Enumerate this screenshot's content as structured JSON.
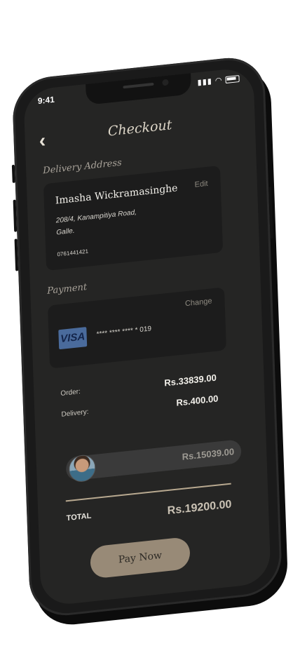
{
  "status": {
    "time": "9:41",
    "signal": "▮▮▮",
    "wifi": "◠"
  },
  "header": {
    "back_icon": "chevron-left-icon",
    "back_glyph": "‹",
    "title": "Checkout"
  },
  "delivery": {
    "label": "Delivery Address",
    "name": "Imasha Wickramasinghe",
    "edit": "Edit",
    "address_line1": "208/4, Kanampitiya Road,",
    "address_line2": "Galle.",
    "phone": "0761441421"
  },
  "payment": {
    "label": "Payment",
    "change": "Change",
    "card_brand": "VISA",
    "card_number": "**** **** **** * 019"
  },
  "summary": {
    "order_label": "Order:",
    "order_value": "Rs.33839.00",
    "delivery_label": "Delivery:",
    "delivery_value": "Rs.400.00",
    "slider_value": "Rs.15039.00",
    "total_label": "TOTAL",
    "total_value": "Rs.19200.00"
  },
  "pay_button": {
    "label": "Pay Now"
  },
  "colors": {
    "screen_bg": "#252524",
    "card_bg": "#1c1c1c",
    "accent": "#988a77",
    "divider": "#b8a990",
    "visa": "#4a6b9c"
  }
}
